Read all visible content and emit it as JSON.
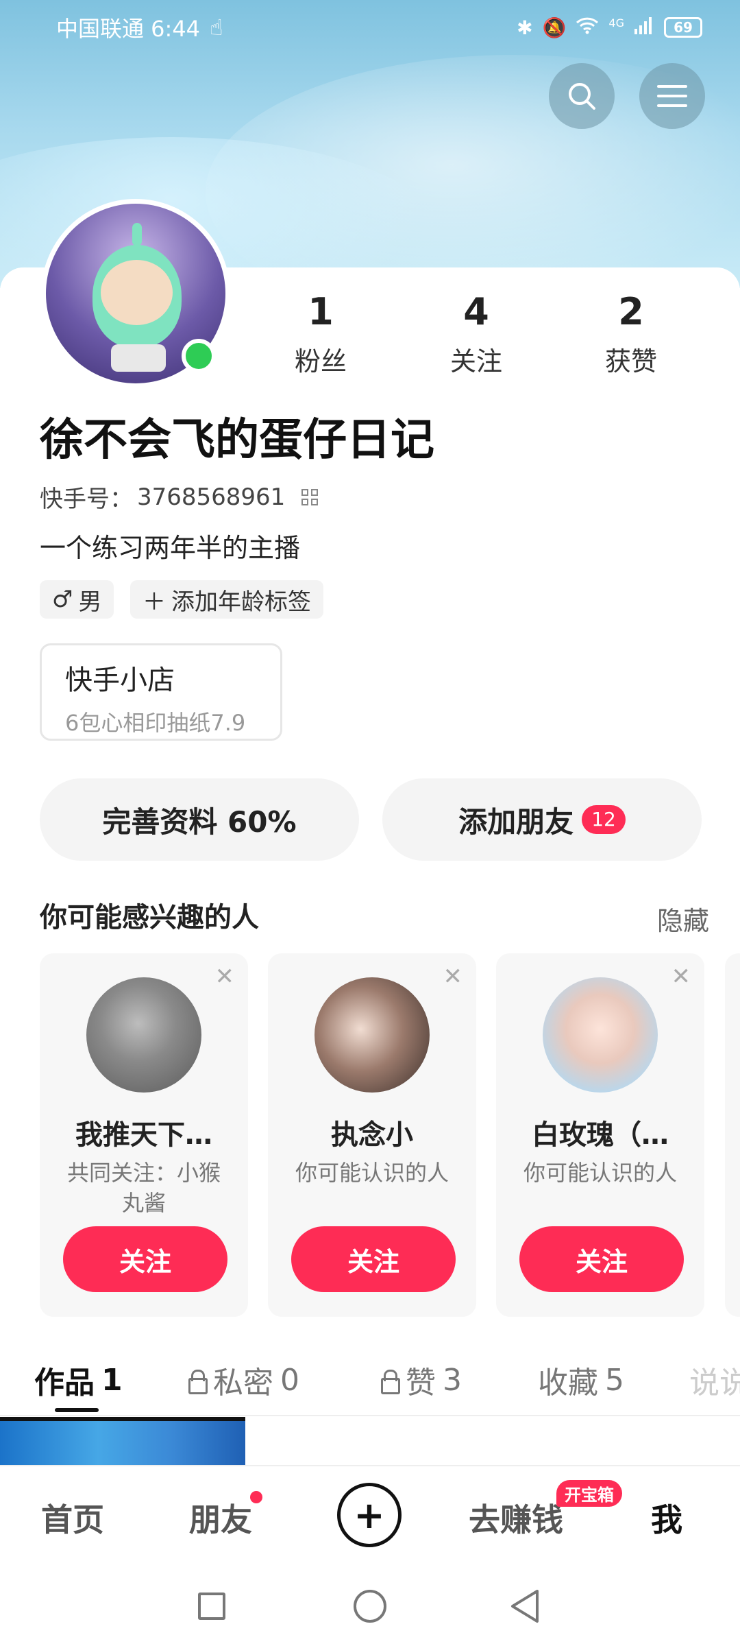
{
  "status_bar": {
    "carrier_time": "中国联通 6:44",
    "network": "4G",
    "battery": "69"
  },
  "profile": {
    "fans_count": "1",
    "fans_label": "粉丝",
    "following_count": "4",
    "following_label": "关注",
    "likes_count": "2",
    "likes_label": "获赞",
    "nickname": "徐不会飞的蛋仔日记",
    "uid_label": "快手号：",
    "uid_value": "3768568961",
    "bio": "一个练习两年半的主播",
    "gender_tag": "男",
    "age_tag": "添加年龄标签"
  },
  "shop": {
    "title": "快手小店",
    "subtitle": "6包心相印抽纸7.9"
  },
  "actions": {
    "complete_profile": "完善资料 60%",
    "add_friends": "添加朋友",
    "add_friends_badge": "12"
  },
  "recommend": {
    "title": "你可能感兴趣的人",
    "hide": "隐藏",
    "cards": [
      {
        "name": "我推天下…",
        "desc": "共同关注：小猴丸酱",
        "follow": "关注"
      },
      {
        "name": "执念小",
        "desc": "你可能认识的人",
        "follow": "关注"
      },
      {
        "name": "白玫瑰（…",
        "desc": "你可能认识的人",
        "follow": "关注"
      }
    ]
  },
  "tabs": [
    {
      "label": "作品",
      "count": "1"
    },
    {
      "label": "私密",
      "count": "0"
    },
    {
      "label": "赞",
      "count": "3"
    },
    {
      "label": "收藏",
      "count": "5"
    },
    {
      "label": "说说",
      "count": ""
    }
  ],
  "bottom_nav": {
    "home": "首页",
    "friends": "朋友",
    "earn": "去赚钱",
    "earn_badge": "开宝箱",
    "me": "我"
  }
}
